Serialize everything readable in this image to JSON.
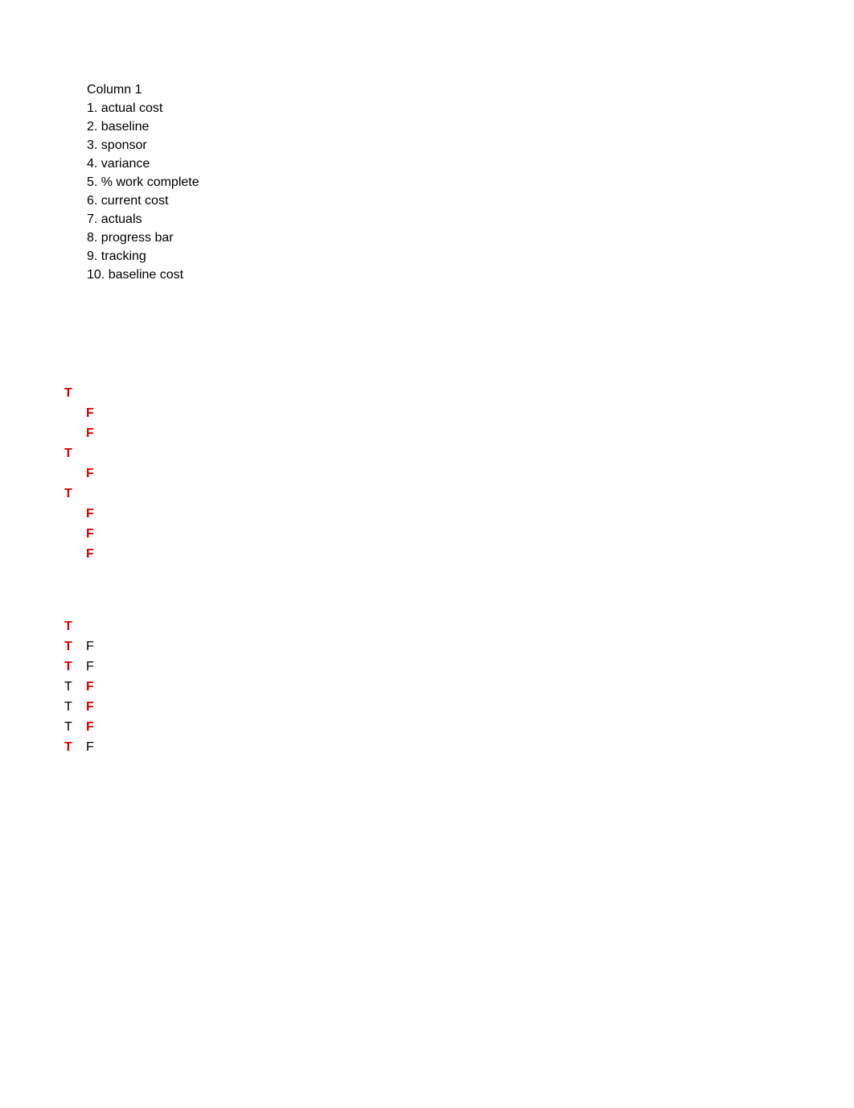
{
  "list": {
    "heading": "Column 1",
    "items": [
      {
        "num": "1.",
        "text": "actual cost"
      },
      {
        "num": "2.",
        "text": "baseline"
      },
      {
        "num": "3.",
        "text": "sponsor"
      },
      {
        "num": "4.",
        "text": "variance"
      },
      {
        "num": "5.",
        "text": "% work complete"
      },
      {
        "num": "6.",
        "text": "current cost"
      },
      {
        "num": "7.",
        "text": "actuals"
      },
      {
        "num": "8.",
        "text": "progress bar"
      },
      {
        "num": "9.",
        "text": "tracking"
      },
      {
        "num": "10.",
        "text": "baseline cost"
      }
    ]
  },
  "tf_group_1": [
    {
      "t": "T",
      "t_style": "red",
      "f": "",
      "f_style": ""
    },
    {
      "t": "",
      "t_style": "",
      "f": "F",
      "f_style": "red"
    },
    {
      "t": "",
      "t_style": "",
      "f": "F",
      "f_style": "red"
    },
    {
      "t": "T",
      "t_style": "red",
      "f": "",
      "f_style": ""
    },
    {
      "t": "",
      "t_style": "",
      "f": "F",
      "f_style": "red"
    },
    {
      "t": "T",
      "t_style": "red",
      "f": "",
      "f_style": ""
    },
    {
      "t": "",
      "t_style": "",
      "f": "F",
      "f_style": "red"
    },
    {
      "t": "",
      "t_style": "",
      "f": "F",
      "f_style": "red"
    },
    {
      "t": "",
      "t_style": "",
      "f": "F",
      "f_style": "red"
    }
  ],
  "tf_group_2": [
    {
      "t": "T",
      "t_style": "red",
      "f": "",
      "f_style": ""
    },
    {
      "t": "T",
      "t_style": "red",
      "f": "F",
      "f_style": "blk"
    },
    {
      "t": "T",
      "t_style": "red",
      "f": "F",
      "f_style": "blk"
    },
    {
      "t": "T",
      "t_style": "blk",
      "f": "F",
      "f_style": "red"
    },
    {
      "t": "T",
      "t_style": "blk",
      "f": "F",
      "f_style": "red"
    },
    {
      "t": "T",
      "t_style": "blk",
      "f": "F",
      "f_style": "red"
    },
    {
      "t": "T",
      "t_style": "red",
      "f": "F",
      "f_style": "blk"
    }
  ]
}
